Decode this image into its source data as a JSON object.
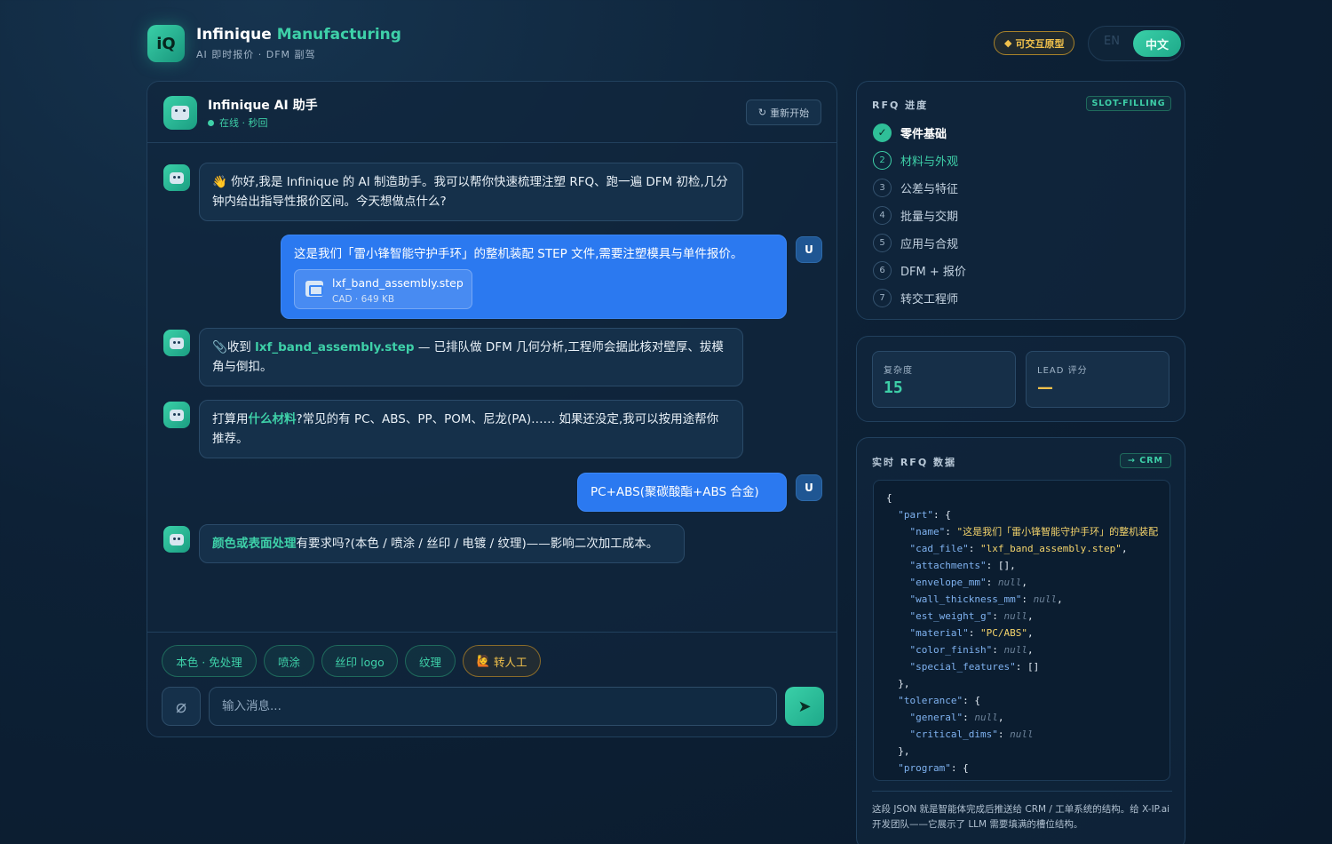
{
  "header": {
    "logo_text": "iQ",
    "brand_name": "Infinique",
    "brand_accent": "Manufacturing",
    "subtitle": "AI 即时报价 · DFM 副驾",
    "badge": "可交互原型",
    "lang_en": "EN",
    "lang_zh": "中文"
  },
  "chat": {
    "title": "Infinique AI 助手",
    "status": "在线 · 秒回",
    "restart_label": "重新开始",
    "messages": [
      {
        "role": "bot",
        "icon": "wave-emoji",
        "text": "你好,我是 Infinique 的 AI 制造助手。我可以帮你快速梳理注塑 RFQ、跑一遍 DFM 初检,几分钟内给出指导性报价区间。今天想做点什么?"
      },
      {
        "role": "user",
        "text": "这是我们「雷小锋智能守护手环」的整机装配 STEP 文件,需要注塑模具与单件报价。",
        "file_name": "lxf_band_assembly.step",
        "file_meta": "CAD · 649 KB"
      },
      {
        "role": "bot",
        "icon": "paperclip-emoji",
        "prefix": "收到 ",
        "highlight": "lxf_band_assembly.step",
        "text": " — 已排队做 DFM 几何分析,工程师会据此核对壁厚、拔模角与倒扣。"
      },
      {
        "role": "bot",
        "prefix": "打算用",
        "highlight": "什么材料",
        "text": "?常见的有 PC、ABS、PP、POM、尼龙(PA)…… 如果还没定,我可以按用途帮你推荐。"
      },
      {
        "role": "user",
        "text": "PC+ABS(聚碳酸酯+ABS 合金)"
      },
      {
        "role": "bot",
        "highlight": "颜色或表面处理",
        "text": "有要求吗?(本色 / 喷涂 / 丝印 / 电镀 / 纹理)——影响二次加工成本。"
      }
    ],
    "user_avatar": "U",
    "quick_replies": [
      "本色 · 免处理",
      "喷涂",
      "丝印 logo",
      "纹理"
    ],
    "human_handoff": "转人工",
    "input_placeholder": "输入消息..."
  },
  "progress": {
    "title": "RFQ 进度",
    "tag": "SLOT-FILLING",
    "steps": [
      {
        "num": "✓",
        "label": "零件基础",
        "state": "done"
      },
      {
        "num": "2",
        "label": "材料与外观",
        "state": "active"
      },
      {
        "num": "3",
        "label": "公差与特征",
        "state": "pending"
      },
      {
        "num": "4",
        "label": "批量与交期",
        "state": "pending"
      },
      {
        "num": "5",
        "label": "应用与合规",
        "state": "pending"
      },
      {
        "num": "6",
        "label": "DFM + 报价",
        "state": "pending"
      },
      {
        "num": "7",
        "label": "转交工程师",
        "state": "pending"
      }
    ]
  },
  "stats": {
    "complexity_label": "复杂度",
    "complexity_value": "15",
    "lead_label": "LEAD 评分",
    "lead_value": "—"
  },
  "rfq": {
    "title": "实时 RFQ 数据",
    "tag": "→ CRM",
    "json_lines": [
      [
        [
          "p",
          "{"
        ]
      ],
      [
        [
          "p",
          "  "
        ],
        [
          "k",
          "\"part\""
        ],
        [
          "p",
          ": {"
        ]
      ],
      [
        [
          "p",
          "    "
        ],
        [
          "k",
          "\"name\""
        ],
        [
          "p",
          ": "
        ],
        [
          "s",
          "\"这是我们「雷小锋智能守护手环」的整机装配"
        ]
      ],
      [
        [
          "p",
          "    "
        ],
        [
          "k",
          "\"cad_file\""
        ],
        [
          "p",
          ": "
        ],
        [
          "s",
          "\"lxf_band_assembly.step\""
        ],
        [
          "p",
          ","
        ]
      ],
      [
        [
          "p",
          "    "
        ],
        [
          "k",
          "\"attachments\""
        ],
        [
          "p",
          ": [],"
        ]
      ],
      [
        [
          "p",
          "    "
        ],
        [
          "k",
          "\"envelope_mm\""
        ],
        [
          "p",
          ": "
        ],
        [
          "n",
          "null"
        ],
        [
          "p",
          ","
        ]
      ],
      [
        [
          "p",
          "    "
        ],
        [
          "k",
          "\"wall_thickness_mm\""
        ],
        [
          "p",
          ": "
        ],
        [
          "n",
          "null"
        ],
        [
          "p",
          ","
        ]
      ],
      [
        [
          "p",
          "    "
        ],
        [
          "k",
          "\"est_weight_g\""
        ],
        [
          "p",
          ": "
        ],
        [
          "n",
          "null"
        ],
        [
          "p",
          ","
        ]
      ],
      [
        [
          "p",
          "    "
        ],
        [
          "k",
          "\"material\""
        ],
        [
          "p",
          ": "
        ],
        [
          "s",
          "\"PC/ABS\""
        ],
        [
          "p",
          ","
        ]
      ],
      [
        [
          "p",
          "    "
        ],
        [
          "k",
          "\"color_finish\""
        ],
        [
          "p",
          ": "
        ],
        [
          "n",
          "null"
        ],
        [
          "p",
          ","
        ]
      ],
      [
        [
          "p",
          "    "
        ],
        [
          "k",
          "\"special_features\""
        ],
        [
          "p",
          ": []"
        ]
      ],
      [
        [
          "p",
          "  },"
        ]
      ],
      [
        [
          "p",
          "  "
        ],
        [
          "k",
          "\"tolerance\""
        ],
        [
          "p",
          ": {"
        ]
      ],
      [
        [
          "p",
          "    "
        ],
        [
          "k",
          "\"general\""
        ],
        [
          "p",
          ": "
        ],
        [
          "n",
          "null"
        ],
        [
          "p",
          ","
        ]
      ],
      [
        [
          "p",
          "    "
        ],
        [
          "k",
          "\"critical_dims\""
        ],
        [
          "p",
          ": "
        ],
        [
          "n",
          "null"
        ]
      ],
      [
        [
          "p",
          "  },"
        ]
      ],
      [
        [
          "p",
          "  "
        ],
        [
          "k",
          "\"program\""
        ],
        [
          "p",
          ": {"
        ]
      ]
    ],
    "note": "这段 JSON 就是智能体完成后推送给 CRM / 工单系统的结构。给 X-IP.ai 开发团队——它展示了 LLM 需要填满的槽位结构。"
  },
  "colors": {
    "accent": "#3ed0a8",
    "user_bubble": "#2b79f0",
    "warning": "#f1c14c",
    "background": "#0d2136"
  }
}
